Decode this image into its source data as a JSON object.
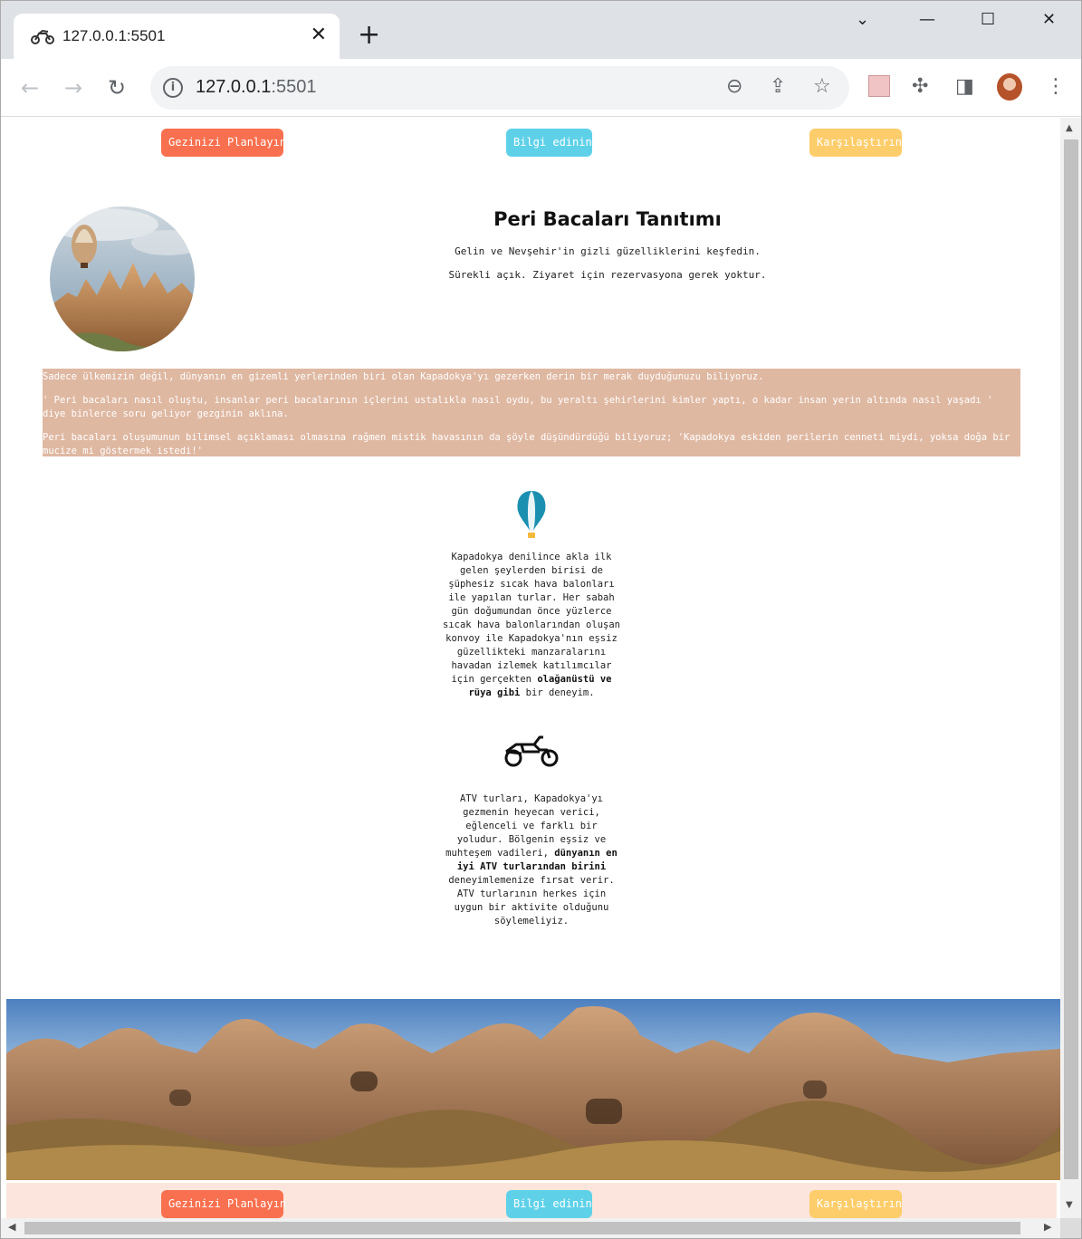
{
  "browser": {
    "tab_title": "127.0.0.1:5501",
    "url_host": "127.0.0.1",
    "url_port": ":5501"
  },
  "nav": {
    "plan": "Gezinizi Planlayın",
    "info": "Bilgi edinin",
    "compare": "Karşılaştırın"
  },
  "hero": {
    "title": "Peri Bacaları Tanıtımı",
    "line1": "Gelin ve Nevşehir'in gizli güzelliklerini keşfedin.",
    "line2": "Sürekli açık. Ziyaret için rezervasyona gerek yoktur."
  },
  "intro": {
    "p1": "Sadece ülkemizin değil, dünyanın en gizemli yerlerinden biri olan Kapadokya'yı gezerken derin bir merak duyduğunuzu biliyoruz.",
    "p2": "' Peri bacaları nasıl oluştu, insanlar peri bacalarının içlerini ustalıkla nasıl oydu, bu yeraltı şehirlerini kimler yaptı, o kadar insan yerin altında nasıl yaşadı ' diye binlerce soru geliyor gezginin aklına.",
    "p3": "Peri bacaları oluşumunun bilimsel açıklaması olmasına rağmen mistik havasının da şöyle düşündürdüğü biliyoruz; 'Kapadokya eskiden perilerin cenneti miydi, yoksa doğa bir mucize mi göstermek istedi!'"
  },
  "balloon_section": {
    "text_before": "Kapadokya denilince akla ilk gelen şeylerden birisi de şüphesiz sıcak hava balonları ile yapılan turlar. Her sabah gün doğumundan önce yüzlerce sıcak hava balonlarından oluşan konvoy ile Kapadokya'nın eşsiz güzellikteki manzaralarını havadan izlemek katılımcılar için gerçekten ",
    "bold": "olağanüstü ve rüya gibi",
    "text_after": " bir deneyim."
  },
  "atv_section": {
    "text_before": "ATV turları, Kapadokya'yı gezmenin heyecan verici, eğlenceli ve farklı bir yoludur. Bölgenin eşsiz ve muhteşem vadileri, ",
    "bold": "dünyanın en iyi ATV turlarından birini",
    "text_after": " deneyimlemenize fırsat verir. ATV turlarının herkes için uygun bir aktivite olduğunu söylemeliyiz."
  },
  "footer_nav": {
    "plan": "Gezinizi Planlayın",
    "info": "Bilgi edinin",
    "compare": "Karşılaştırın"
  },
  "colors": {
    "plan": "#f8704f",
    "info": "#5ed1e8",
    "compare": "#fdcd6b",
    "intro_bg": "#dfb8a2",
    "footer_bg": "#fbe5dc"
  }
}
